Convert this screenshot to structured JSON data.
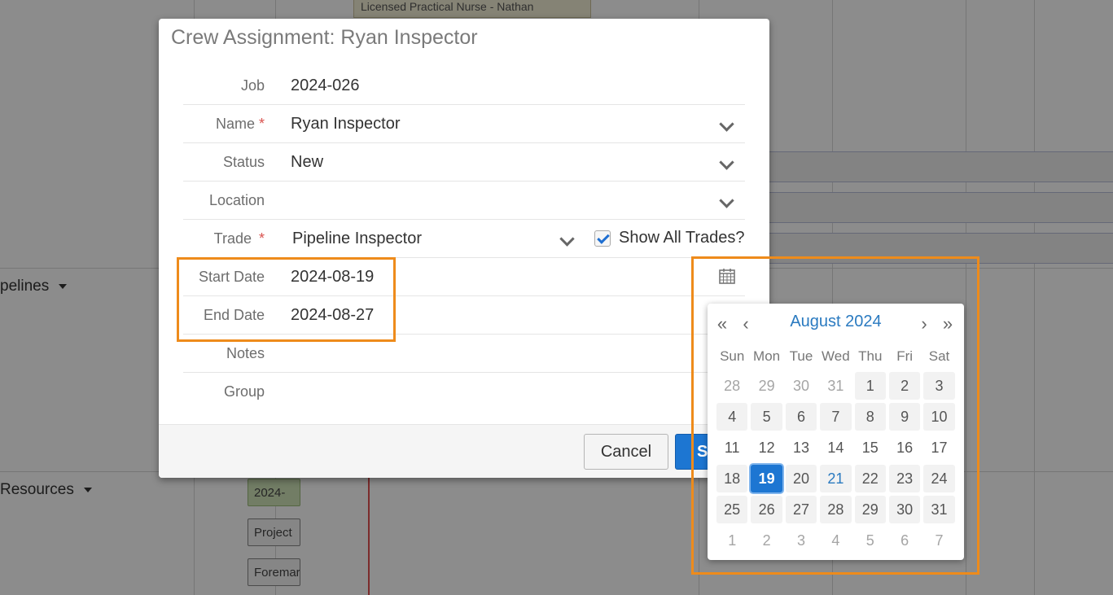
{
  "background": {
    "top_bar_text": "Licensed Practical Nurse - Nathan",
    "groups": [
      "pelines",
      "Resources"
    ],
    "chips": [
      "2024-",
      "Project",
      "Foremar"
    ]
  },
  "modal": {
    "title": "Crew Assignment: Ryan Inspector",
    "fields": {
      "job": {
        "label": "Job",
        "value": "2024-026"
      },
      "name": {
        "label": "Name",
        "value": "Ryan Inspector",
        "required": "*"
      },
      "status": {
        "label": "Status",
        "value": "New"
      },
      "location": {
        "label": "Location",
        "value": ""
      },
      "trade": {
        "label": "Trade",
        "value": "Pipeline Inspector",
        "required": "*",
        "show_all_label": "Show All Trades?",
        "show_all_checked": true
      },
      "start_date": {
        "label": "Start Date",
        "value": "2024-08-19"
      },
      "end_date": {
        "label": "End Date",
        "value": "2024-08-27"
      },
      "notes": {
        "label": "Notes",
        "value": ""
      },
      "group": {
        "label": "Group",
        "value": ""
      }
    },
    "footer": {
      "cancel_label": "Cancel",
      "save_label": "S"
    }
  },
  "datepicker": {
    "month_title": "August 2024",
    "nav": {
      "first": "«",
      "prev": "‹",
      "next": "›",
      "last": "»"
    },
    "weekdays": [
      "Sun",
      "Mon",
      "Tue",
      "Wed",
      "Thu",
      "Fri",
      "Sat"
    ],
    "selected_day": "19",
    "highlighted_day": "21",
    "weeks": [
      [
        "28",
        "29",
        "30",
        "31",
        "1",
        "2",
        "3"
      ],
      [
        "4",
        "5",
        "6",
        "7",
        "8",
        "9",
        "10"
      ],
      [
        "11",
        "12",
        "13",
        "14",
        "15",
        "16",
        "17"
      ],
      [
        "18",
        "19",
        "20",
        "21",
        "22",
        "23",
        "24"
      ],
      [
        "25",
        "26",
        "27",
        "28",
        "29",
        "30",
        "31"
      ],
      [
        "1",
        "2",
        "3",
        "4",
        "5",
        "6",
        "7"
      ]
    ]
  },
  "colors": {
    "accent": "#1d76d2",
    "highlight_box": "#ee8b1b",
    "required": "#d9534f"
  }
}
